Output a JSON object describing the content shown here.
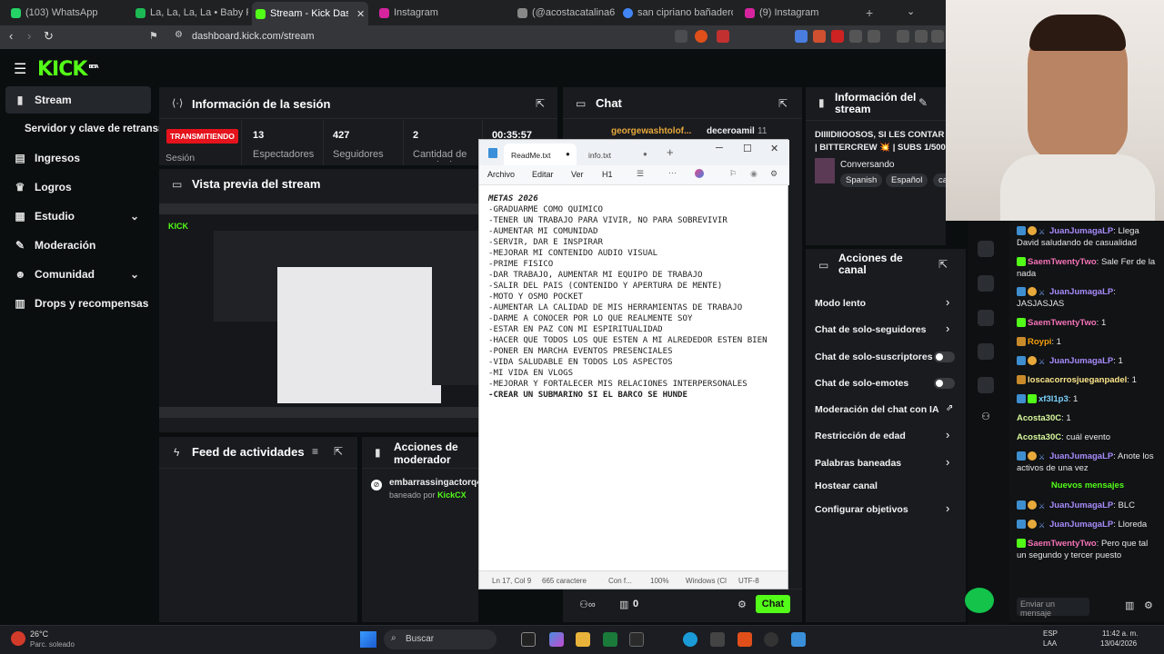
{
  "browser": {
    "tabs": [
      {
        "label": "(103) WhatsApp",
        "color": "#25d366"
      },
      {
        "label": "La, La, La, La • Baby Rasta",
        "color": "#1db954"
      },
      {
        "label": "Stream - Kick Dashboard",
        "color": "#53fc18"
      },
      {
        "label": "Instagram",
        "color": "#d6249f"
      },
      {
        "label": "(@acostacatalina6",
        "color": "#888888"
      },
      {
        "label": "san cipriano bañadero - Bus",
        "color": "#4285f4"
      },
      {
        "label": "(9) Instagram",
        "color": "#d6249f"
      }
    ],
    "url": "dashboard.kick.com/stream"
  },
  "kick": {
    "logo": "KICK",
    "logo_sup": "BETA",
    "sidebar": [
      {
        "label": "Stream",
        "icon": "broadcast-icon"
      },
      {
        "label": "Servidor y clave de retransn",
        "icon": ""
      },
      {
        "label": "Ingresos",
        "icon": "chart-icon"
      },
      {
        "label": "Logros",
        "icon": "trophy-icon"
      },
      {
        "label": "Estudio",
        "icon": "grid-icon"
      },
      {
        "label": "Moderación",
        "icon": "wrench-icon"
      },
      {
        "label": "Comunidad",
        "icon": "users-icon"
      },
      {
        "label": "Drops y recompensas",
        "icon": "gift-icon"
      }
    ]
  },
  "session": {
    "title": "Información de la sesión",
    "status": "TRANSMITIENDO",
    "status_label": "Sesión",
    "stats": [
      {
        "value": "13",
        "label": "Espectadores"
      },
      {
        "value": "427",
        "label": "Seguidores"
      },
      {
        "value": "2",
        "label": "Cantidad de suscripciones"
      },
      {
        "value": "00:35:57",
        "label": ""
      }
    ]
  },
  "preview": {
    "title": "Vista previa del stream"
  },
  "activity": {
    "title": "Feed de actividades"
  },
  "modactions": {
    "title": "Acciones de moderador",
    "user": "embarrassingactorq4",
    "by_prefix": "baneado por",
    "by": "KickCX"
  },
  "chat_panel": {
    "title": "Chat",
    "user1": "georgewashtolof...",
    "user2": "decerоamil",
    "user2_count": "11",
    "send_button": "Chat",
    "count": "0"
  },
  "stream_info": {
    "title": "Información del stream",
    "stream_title": "DIIIIDIIOOSOS, SI LES CONTAR | BITTERCREW 💥 | SUBS 1/500",
    "category": "Conversando",
    "tags": [
      "Spanish",
      "Español",
      "ca"
    ]
  },
  "channel_actions": {
    "title": "Acciones de canal",
    "rows": [
      {
        "label": "Modo lento",
        "control": "chevron"
      },
      {
        "label": "Chat de solo-seguidores",
        "control": "chevron"
      },
      {
        "label": "Chat de solo-suscriptores",
        "control": "toggle"
      },
      {
        "label": "Chat de solo-emotes",
        "control": "toggle"
      },
      {
        "label": "Moderación del chat con IA",
        "control": "external"
      },
      {
        "label": "Restricción de edad",
        "control": "chevron"
      },
      {
        "label": "Palabras baneadas",
        "control": "chevron"
      },
      {
        "label": "Hostear canal",
        "control": "none"
      },
      {
        "label": "Configurar objetivos",
        "control": "chevron"
      }
    ]
  },
  "notepad": {
    "tabs": [
      "ReadMe.txt",
      "info.txt"
    ],
    "menu": [
      "Archivo",
      "Editar",
      "Ver",
      "H1"
    ],
    "lines": [
      "METAS 2026",
      "-GRADUARME COMO QUIMICO",
      "-TENER UN TRABAJO PARA VIVIR, NO PARA SOBREVIVIR",
      "-AUMENTAR MI COMUNIDAD",
      "-SERVIR, DAR E INSPIRAR",
      "-MEJORAR MI CONTENIDO AUDIO VISUAL",
      "-PRIME FISICO",
      "-DAR TRABAJO, AUMENTAR MI EQUIPO DE TRABAJO",
      "-SALIR DEL PAIS (CONTENIDO Y APERTURA DE MENTE)",
      "-MOTO Y OSMO POCKET",
      "-AUMENTAR LA CALIDAD DE MIS HERRAMIENTAS DE TRABAJO",
      "-DARME A CONOCER POR LO QUE REALMENTE SOY",
      "-ESTAR EN PAZ CON MI ESPIRITUALIDAD",
      "-HACER QUE TODOS LOS QUE ESTEN A MI ALREDEDOR ESTEN BIEN",
      "-PONER EN MARCHA EVENTOS PRESENCIALES",
      "-VIDA SALUDABLE EN TODOS LOS ASPECTOS",
      "-MI VIDA EN VLOGS",
      "-MEJORAR Y FORTALECER MIS RELACIONES INTERPERSONALES",
      "-CREAR UN SUBMARINO SI EL BARCO SE HUNDE"
    ],
    "status": [
      "Ln 17, Col 9",
      "665 caractere",
      "Con f...",
      "100%",
      "Windows (Cl",
      "UTF-8"
    ]
  },
  "chat_feed": [
    {
      "user": "JuanJumagaLP",
      "text": "Llega David saludando de casualidad",
      "color": "#a78bfa",
      "badges": [
        "b",
        "y",
        "s"
      ]
    },
    {
      "user": "SaemTwentyTwo",
      "text": "Sale Fer de la nada",
      "color": "#f472b6",
      "badges": [
        "g"
      ]
    },
    {
      "user": "JuanJumagaLP",
      "text": "JASJASJAS",
      "color": "#a78bfa",
      "badges": [
        "b",
        "y",
        "s"
      ]
    },
    {
      "user": "SaemTwentyTwo",
      "text": "1",
      "color": "#f472b6",
      "badges": [
        "g"
      ]
    },
    {
      "user": "Roypi",
      "text": "1",
      "color": "#f59e0b",
      "badges": [
        "o"
      ]
    },
    {
      "user": "JuanJumagaLP",
      "text": "1",
      "color": "#a78bfa",
      "badges": [
        "b",
        "y",
        "s"
      ]
    },
    {
      "user": "loscacorrosjueganpadel",
      "text": "1",
      "color": "#fde68a",
      "badges": [
        "o"
      ]
    },
    {
      "user": "xf3l1p3",
      "text": "1",
      "color": "#7dd3fc",
      "badges": [
        "b",
        "g"
      ]
    },
    {
      "user": "Acosta30C",
      "text": "1",
      "color": "#d9f99d",
      "badges": []
    },
    {
      "user": "Acosta30C",
      "text": "cuál evento",
      "color": "#d9f99d",
      "badges": []
    },
    {
      "user": "JuanJumagaLP",
      "text": "Anote los activos de una vez",
      "color": "#a78bfa",
      "badges": [
        "b",
        "y",
        "s"
      ]
    }
  ],
  "chat_feed_divider": "Nuevos mensajes",
  "chat_feed_new": [
    {
      "user": "JuanJumagaLP",
      "text": "BLC",
      "color": "#a78bfa",
      "badges": [
        "b",
        "y",
        "s"
      ]
    },
    {
      "user": "JuanJumagaLP",
      "text": "Lloreda",
      "color": "#a78bfa",
      "badges": [
        "b",
        "y",
        "s"
      ]
    },
    {
      "user": "SaemTwentyTwo",
      "text": "Pero que tal un segundo y tercer puesto",
      "color": "#f472b6",
      "badges": [
        "g"
      ]
    }
  ],
  "chat_input_placeholder": "Enviar un mensaje",
  "taskbar": {
    "weather_temp": "26°C",
    "weather_desc": "Parc. soleado",
    "search": "Buscar",
    "lang1": "ESP",
    "lang2": "LAA",
    "time": "11:42 a. m.",
    "date": "13/04/2026"
  }
}
